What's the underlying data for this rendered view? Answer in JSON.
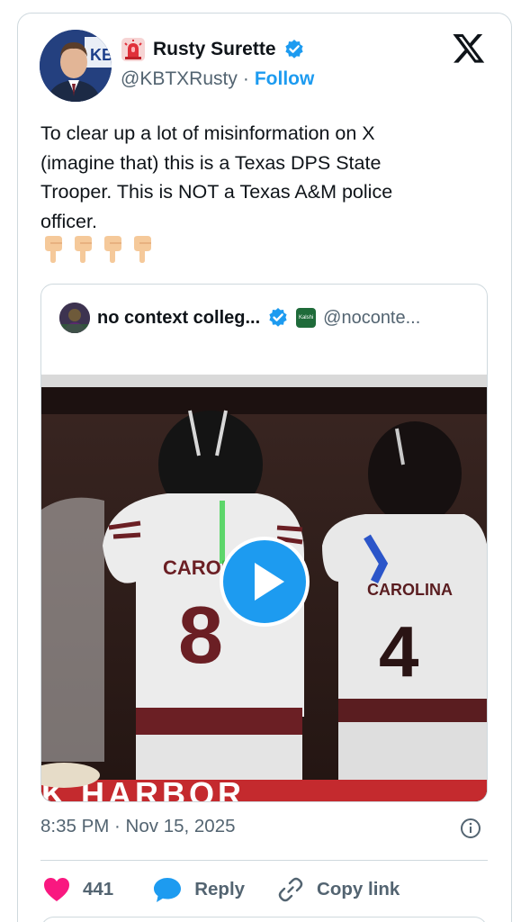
{
  "author": {
    "display_name": "Rusty Surette",
    "handle": "@KBTXRusty",
    "separator": "·",
    "follow_label": "Follow",
    "avatar_badge": "KB",
    "verified": true
  },
  "tweet": {
    "text": "To clear up a lot of misinformation on X\n(imagine that) this is a Texas DPS State\nTrooper. This is NOT a Texas A&M police\nofficer.",
    "emojis": [
      "point-down",
      "point-down",
      "point-down",
      "point-down"
    ],
    "timestamp": "8:35 PM · Nov 15, 2025"
  },
  "quoted_tweet": {
    "display_name": "no context colleg...",
    "handle": "@noconte...",
    "affiliate_badge": "Kalshi",
    "verified": true,
    "video": {
      "jersey_text_left": "CAROLINA",
      "jersey_number_left": "8",
      "jersey_text_right": "CAROLINA",
      "jersey_number_right": "4",
      "banner_text": "K HARBOR"
    }
  },
  "actions": {
    "likes_count": "441",
    "reply_label": "Reply",
    "copy_link_label": "Copy link"
  },
  "colors": {
    "accent": "#1d9bf0",
    "like": "#f91880",
    "text_secondary": "#536471",
    "border": "#cfd9de"
  }
}
